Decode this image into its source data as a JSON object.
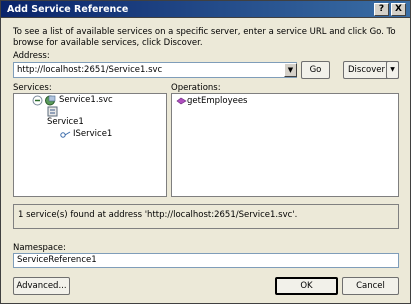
{
  "window": {
    "title": "Add Service Reference",
    "help_label": "?",
    "close_label": "X"
  },
  "description": "To see a list of available services on a specific server, enter a service URL and click Go. To browse for available services, click Discover.",
  "address": {
    "label": "Address:",
    "value": "http://localhost:2651/Service1.svc",
    "go_label": "Go",
    "discover_label": "Discover"
  },
  "services": {
    "label": "Services:",
    "items": [
      {
        "label": "Service1.svc",
        "icon": "service-globe-icon"
      },
      {
        "label": "Service1",
        "icon": "service-class-icon"
      },
      {
        "label": "IService1",
        "icon": "interface-icon"
      }
    ]
  },
  "operations": {
    "label": "Operations:",
    "items": [
      {
        "label": "getEmployees",
        "icon": "method-icon"
      }
    ]
  },
  "status_text": "1 service(s) found at address 'http://localhost:2651/Service1.svc'.",
  "namespace": {
    "label": "Namespace:",
    "value": "ServiceReference1"
  },
  "buttons": {
    "advanced": "Advanced...",
    "ok": "OK",
    "cancel": "Cancel"
  }
}
